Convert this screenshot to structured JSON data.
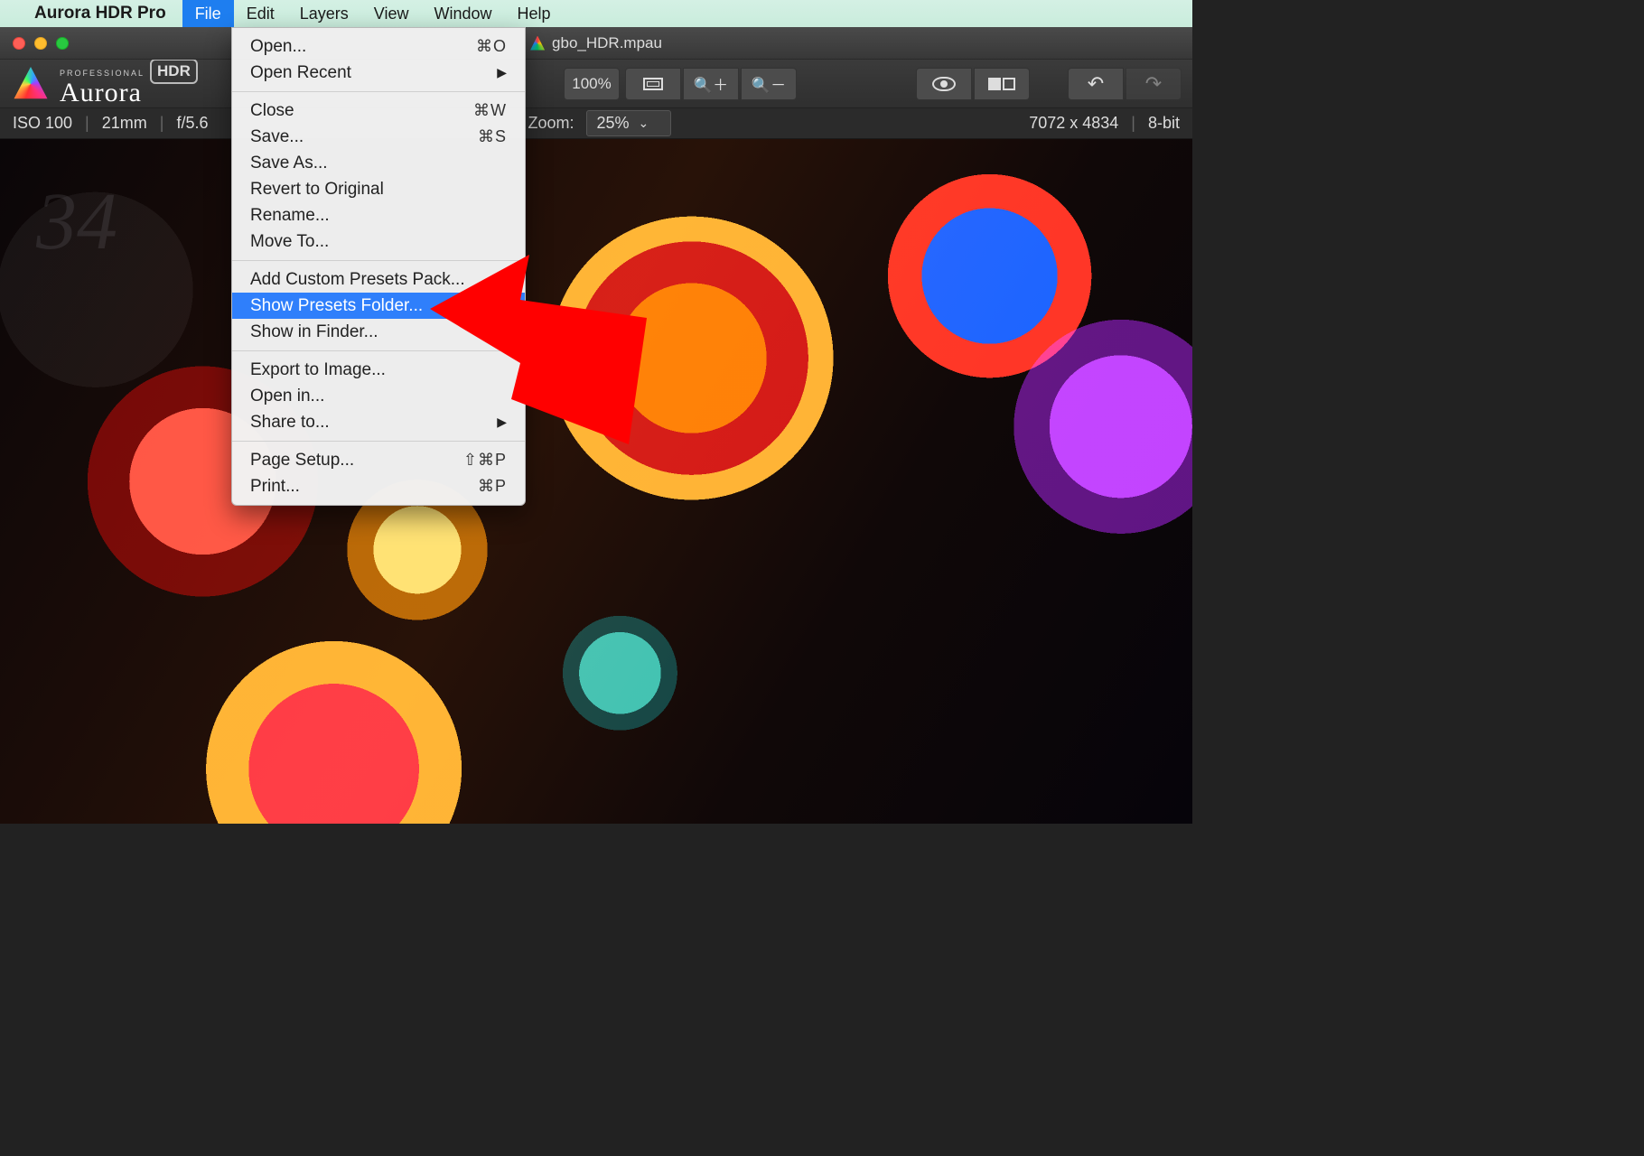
{
  "menubar": {
    "appname": "Aurora HDR Pro",
    "items": [
      "File",
      "Edit",
      "Layers",
      "View",
      "Window",
      "Help"
    ],
    "active": "File"
  },
  "window": {
    "document_name": "gbo_HDR.mpau"
  },
  "toolbar": {
    "logo_professional": "PROFESSIONAL",
    "logo_name": "Aurora",
    "logo_badge": "HDR",
    "zoom_pct_label": "100%"
  },
  "infobar": {
    "iso": "ISO 100",
    "focal": "21mm",
    "aperture": "f/5.6",
    "zoom_label": "Zoom:",
    "zoom_value": "25%",
    "dimensions": "7072 x 4834",
    "bitdepth": "8-bit"
  },
  "dropdown": {
    "groups": [
      [
        {
          "label": "Open...",
          "shortcut": "⌘O"
        },
        {
          "label": "Open Recent",
          "submenu": true
        }
      ],
      [
        {
          "label": "Close",
          "shortcut": "⌘W"
        },
        {
          "label": "Save...",
          "shortcut": "⌘S"
        },
        {
          "label": "Save As..."
        },
        {
          "label": "Revert to Original"
        },
        {
          "label": "Rename..."
        },
        {
          "label": "Move To..."
        }
      ],
      [
        {
          "label": "Add Custom Presets Pack..."
        },
        {
          "label": "Show Presets Folder...",
          "highlight": true
        },
        {
          "label": "Show in Finder..."
        }
      ],
      [
        {
          "label": "Export to Image..."
        },
        {
          "label": "Open in..."
        },
        {
          "label": "Share to...",
          "submenu": true
        }
      ],
      [
        {
          "label": "Page Setup...",
          "shortcut": "⇧⌘P"
        },
        {
          "label": "Print...",
          "shortcut": "⌘P"
        }
      ]
    ]
  },
  "ghost_number": "34"
}
